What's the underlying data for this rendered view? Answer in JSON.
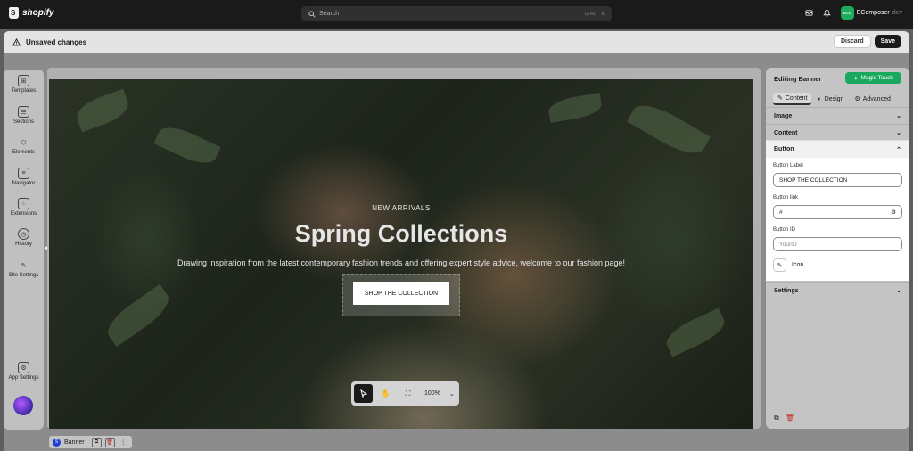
{
  "topbar": {
    "logo_text": "shopify",
    "search_placeholder": "Search",
    "shortcut_key": "CTRL",
    "shortcut_extra": "K",
    "store_badge": "ECO",
    "store_name": "EComposer",
    "store_sub": "dev"
  },
  "unsaved": {
    "title": "Unsaved changes",
    "discard_label": "Discard",
    "save_label": "Save"
  },
  "sidebar": {
    "items": [
      {
        "label": "Templates",
        "icon": "templates-icon"
      },
      {
        "label": "Sections",
        "icon": "sections-icon"
      },
      {
        "label": "Elements",
        "icon": "elements-icon"
      },
      {
        "label": "Navigator",
        "icon": "navigator-icon"
      },
      {
        "label": "Extensions",
        "icon": "extensions-icon"
      },
      {
        "label": "History",
        "icon": "history-icon"
      },
      {
        "label": "Site Settings",
        "icon": "site-settings-icon"
      },
      {
        "label": "App Settings",
        "icon": "app-settings-icon"
      }
    ]
  },
  "banner": {
    "subheading": "NEW ARRIVALS",
    "heading": "Spring Collections",
    "description": "Drawing inspiration from the latest contemporary fashion trends and offering expert style advice, welcome to our fashion page!",
    "cta_label": "SHOP THE COLLECTION"
  },
  "toolbar": {
    "zoom": "100%"
  },
  "panel": {
    "title": "Editing Banner",
    "magic_label": "Magic Touch",
    "tabs": [
      "Content",
      "Design",
      "Advanced"
    ],
    "sections": {
      "image": "Image",
      "content": "Content",
      "button": "Button",
      "settings": "Settings"
    },
    "button_label_label": "Button Label",
    "button_label_value": "SHOP THE COLLECTION",
    "button_link_label": "Button link",
    "button_link_value": "#",
    "button_id_label": "Button ID",
    "button_id_placeholder": "YourID",
    "icon_label": "Icon"
  },
  "breadcrumb": {
    "label": "Banner"
  },
  "colors": {
    "accent": "#1aa85e",
    "topbar": "#1a1a1a",
    "danger": "#c0281e"
  }
}
